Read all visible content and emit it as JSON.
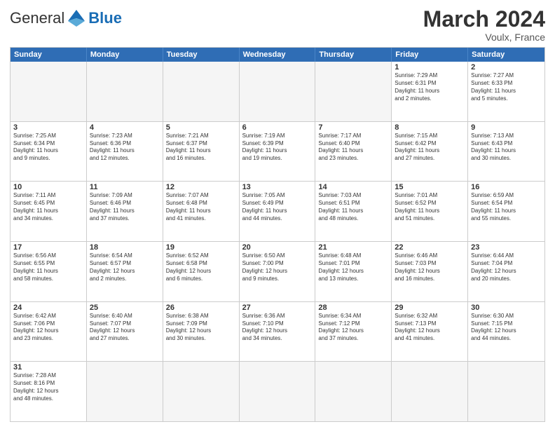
{
  "header": {
    "logo_general": "General",
    "logo_blue": "Blue",
    "month_title": "March 2024",
    "location": "Voulx, France"
  },
  "weekdays": [
    "Sunday",
    "Monday",
    "Tuesday",
    "Wednesday",
    "Thursday",
    "Friday",
    "Saturday"
  ],
  "rows": [
    [
      {
        "day": "",
        "info": ""
      },
      {
        "day": "",
        "info": ""
      },
      {
        "day": "",
        "info": ""
      },
      {
        "day": "",
        "info": ""
      },
      {
        "day": "",
        "info": ""
      },
      {
        "day": "1",
        "info": "Sunrise: 7:29 AM\nSunset: 6:31 PM\nDaylight: 11 hours\nand 2 minutes."
      },
      {
        "day": "2",
        "info": "Sunrise: 7:27 AM\nSunset: 6:33 PM\nDaylight: 11 hours\nand 5 minutes."
      }
    ],
    [
      {
        "day": "3",
        "info": "Sunrise: 7:25 AM\nSunset: 6:34 PM\nDaylight: 11 hours\nand 9 minutes."
      },
      {
        "day": "4",
        "info": "Sunrise: 7:23 AM\nSunset: 6:36 PM\nDaylight: 11 hours\nand 12 minutes."
      },
      {
        "day": "5",
        "info": "Sunrise: 7:21 AM\nSunset: 6:37 PM\nDaylight: 11 hours\nand 16 minutes."
      },
      {
        "day": "6",
        "info": "Sunrise: 7:19 AM\nSunset: 6:39 PM\nDaylight: 11 hours\nand 19 minutes."
      },
      {
        "day": "7",
        "info": "Sunrise: 7:17 AM\nSunset: 6:40 PM\nDaylight: 11 hours\nand 23 minutes."
      },
      {
        "day": "8",
        "info": "Sunrise: 7:15 AM\nSunset: 6:42 PM\nDaylight: 11 hours\nand 27 minutes."
      },
      {
        "day": "9",
        "info": "Sunrise: 7:13 AM\nSunset: 6:43 PM\nDaylight: 11 hours\nand 30 minutes."
      }
    ],
    [
      {
        "day": "10",
        "info": "Sunrise: 7:11 AM\nSunset: 6:45 PM\nDaylight: 11 hours\nand 34 minutes."
      },
      {
        "day": "11",
        "info": "Sunrise: 7:09 AM\nSunset: 6:46 PM\nDaylight: 11 hours\nand 37 minutes."
      },
      {
        "day": "12",
        "info": "Sunrise: 7:07 AM\nSunset: 6:48 PM\nDaylight: 11 hours\nand 41 minutes."
      },
      {
        "day": "13",
        "info": "Sunrise: 7:05 AM\nSunset: 6:49 PM\nDaylight: 11 hours\nand 44 minutes."
      },
      {
        "day": "14",
        "info": "Sunrise: 7:03 AM\nSunset: 6:51 PM\nDaylight: 11 hours\nand 48 minutes."
      },
      {
        "day": "15",
        "info": "Sunrise: 7:01 AM\nSunset: 6:52 PM\nDaylight: 11 hours\nand 51 minutes."
      },
      {
        "day": "16",
        "info": "Sunrise: 6:59 AM\nSunset: 6:54 PM\nDaylight: 11 hours\nand 55 minutes."
      }
    ],
    [
      {
        "day": "17",
        "info": "Sunrise: 6:56 AM\nSunset: 6:55 PM\nDaylight: 11 hours\nand 58 minutes."
      },
      {
        "day": "18",
        "info": "Sunrise: 6:54 AM\nSunset: 6:57 PM\nDaylight: 12 hours\nand 2 minutes."
      },
      {
        "day": "19",
        "info": "Sunrise: 6:52 AM\nSunset: 6:58 PM\nDaylight: 12 hours\nand 6 minutes."
      },
      {
        "day": "20",
        "info": "Sunrise: 6:50 AM\nSunset: 7:00 PM\nDaylight: 12 hours\nand 9 minutes."
      },
      {
        "day": "21",
        "info": "Sunrise: 6:48 AM\nSunset: 7:01 PM\nDaylight: 12 hours\nand 13 minutes."
      },
      {
        "day": "22",
        "info": "Sunrise: 6:46 AM\nSunset: 7:03 PM\nDaylight: 12 hours\nand 16 minutes."
      },
      {
        "day": "23",
        "info": "Sunrise: 6:44 AM\nSunset: 7:04 PM\nDaylight: 12 hours\nand 20 minutes."
      }
    ],
    [
      {
        "day": "24",
        "info": "Sunrise: 6:42 AM\nSunset: 7:06 PM\nDaylight: 12 hours\nand 23 minutes."
      },
      {
        "day": "25",
        "info": "Sunrise: 6:40 AM\nSunset: 7:07 PM\nDaylight: 12 hours\nand 27 minutes."
      },
      {
        "day": "26",
        "info": "Sunrise: 6:38 AM\nSunset: 7:09 PM\nDaylight: 12 hours\nand 30 minutes."
      },
      {
        "day": "27",
        "info": "Sunrise: 6:36 AM\nSunset: 7:10 PM\nDaylight: 12 hours\nand 34 minutes."
      },
      {
        "day": "28",
        "info": "Sunrise: 6:34 AM\nSunset: 7:12 PM\nDaylight: 12 hours\nand 37 minutes."
      },
      {
        "day": "29",
        "info": "Sunrise: 6:32 AM\nSunset: 7:13 PM\nDaylight: 12 hours\nand 41 minutes."
      },
      {
        "day": "30",
        "info": "Sunrise: 6:30 AM\nSunset: 7:15 PM\nDaylight: 12 hours\nand 44 minutes."
      }
    ],
    [
      {
        "day": "31",
        "info": "Sunrise: 7:28 AM\nSunset: 8:16 PM\nDaylight: 12 hours\nand 48 minutes."
      },
      {
        "day": "",
        "info": ""
      },
      {
        "day": "",
        "info": ""
      },
      {
        "day": "",
        "info": ""
      },
      {
        "day": "",
        "info": ""
      },
      {
        "day": "",
        "info": ""
      },
      {
        "day": "",
        "info": ""
      }
    ]
  ]
}
